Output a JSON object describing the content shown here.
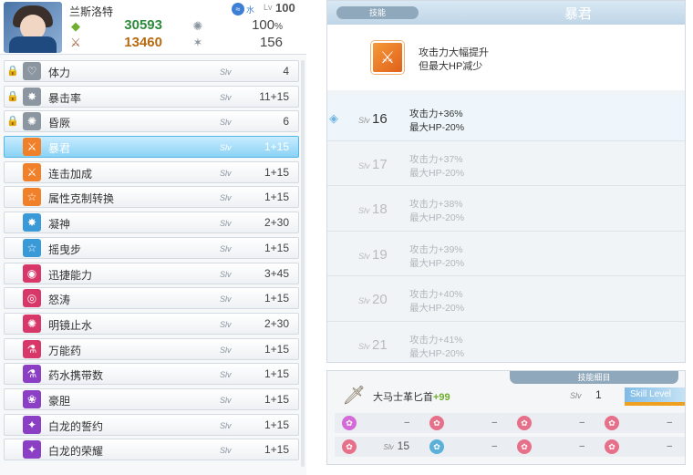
{
  "character": {
    "name": "兰斯洛特",
    "element_label": "水",
    "level_label": "Lv",
    "level": "100",
    "hp": "30593",
    "attack": "13460",
    "crit": "100",
    "crit_unit": "%",
    "defense": "156"
  },
  "skills": [
    {
      "name": "体力",
      "level": "4",
      "locked": true,
      "icon": "heart-icon",
      "color": "#8c96a0"
    },
    {
      "name": "暴击率",
      "level": "11+15",
      "locked": true,
      "icon": "crit-icon",
      "color": "#8c96a0"
    },
    {
      "name": "昏厥",
      "level": "6",
      "locked": true,
      "icon": "stun-icon",
      "color": "#8c96a0"
    },
    {
      "name": "暴君",
      "level": "1+15",
      "locked": false,
      "icon": "tyrant-icon",
      "color": "#f0812a",
      "selected": true
    },
    {
      "name": "连击加成",
      "level": "1+15",
      "locked": false,
      "icon": "sword-icon",
      "color": "#f0812a"
    },
    {
      "name": "属性克制转换",
      "level": "1+15",
      "locked": false,
      "icon": "star-icon",
      "color": "#f0812a"
    },
    {
      "name": "凝神",
      "level": "2+30",
      "locked": false,
      "icon": "focus-icon",
      "color": "#3a9ad8"
    },
    {
      "name": "摇曳步",
      "level": "1+15",
      "locked": false,
      "icon": "star-icon",
      "color": "#3a9ad8"
    },
    {
      "name": "迅捷能力",
      "level": "3+45",
      "locked": false,
      "icon": "speed-icon",
      "color": "#d8376a"
    },
    {
      "name": "怒涛",
      "level": "1+15",
      "locked": false,
      "icon": "wave-icon",
      "color": "#d8376a"
    },
    {
      "name": "明镜止水",
      "level": "2+30",
      "locked": false,
      "icon": "mirror-icon",
      "color": "#d8376a"
    },
    {
      "name": "万能药",
      "level": "1+15",
      "locked": false,
      "icon": "potion-icon",
      "color": "#d8376a"
    },
    {
      "name": "药水携带数",
      "level": "1+15",
      "locked": false,
      "icon": "potion-icon",
      "color": "#8a3fc4"
    },
    {
      "name": "豪胆",
      "level": "1+15",
      "locked": false,
      "icon": "courage-icon",
      "color": "#8a3fc4"
    },
    {
      "name": "白龙的誓约",
      "level": "1+15",
      "locked": false,
      "icon": "dragon-icon",
      "color": "#8a3fc4"
    },
    {
      "name": "白龙的荣耀",
      "level": "1+15",
      "locked": false,
      "icon": "dragon-icon",
      "color": "#8a3fc4"
    }
  ],
  "skill_level_label": "Slv",
  "detail": {
    "section_tag": "技能",
    "title": "暴君",
    "desc_line1": "攻击力大幅提升",
    "desc_line2": "但最大HP减少",
    "levels": [
      {
        "slv": "16",
        "line1": "攻击力+36%",
        "line2": "最大HP-20%",
        "current": true
      },
      {
        "slv": "17",
        "line1": "攻击力+37%",
        "line2": "最大HP-20%"
      },
      {
        "slv": "18",
        "line1": "攻击力+38%",
        "line2": "最大HP-20%"
      },
      {
        "slv": "19",
        "line1": "攻击力+39%",
        "line2": "最大HP-20%"
      },
      {
        "slv": "20",
        "line1": "攻击力+40%",
        "line2": "最大HP-20%"
      },
      {
        "slv": "21",
        "line1": "攻击力+41%",
        "line2": "最大HP-20%"
      }
    ]
  },
  "weapon": {
    "section_tag": "技能细目",
    "name": "大马士革匕首",
    "plus": "+99",
    "slv": "1",
    "skill_level_tag": "Skill Level",
    "slots_row1": [
      {
        "icon_color": "#d36ad8",
        "value": "–"
      },
      {
        "icon_color": "#e6708a",
        "value": "–"
      },
      {
        "icon_color": "#e6708a",
        "value": "–"
      },
      {
        "icon_color": "#e6708a",
        "value": "–"
      }
    ],
    "slots_row2": [
      {
        "icon_color": "#e6708a",
        "value": "15",
        "label": "Slv"
      },
      {
        "icon_color": "#5ab0d8",
        "value": "–"
      },
      {
        "icon_color": "#e6708a",
        "value": "–"
      },
      {
        "icon_color": "#e6708a",
        "value": "–"
      }
    ]
  }
}
